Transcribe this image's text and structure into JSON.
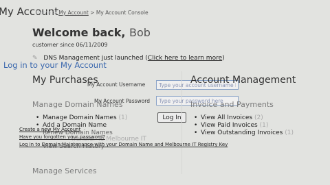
{
  "page_title": "My Account",
  "breadcrumb": {
    "home": "Home",
    "sep1": ">",
    "account": "My Account",
    "sep2": ">",
    "current": "My Account Console"
  },
  "welcome": {
    "greeting": "Welcome back,",
    "name": "Bob",
    "customer_since": "customer since 06/11/2009"
  },
  "announcement": {
    "text": "DNS Management just launched (",
    "link": "Click here to learn more",
    "close": ")"
  },
  "login_overlay": {
    "title": "Log in to your My Account",
    "username_label": "My Account Username",
    "username_placeholder": "Type your account username here",
    "password_label": "My Account Password",
    "password_placeholder": "Type your password here",
    "login_button": "Log In",
    "create_link": "Create a new My Account",
    "forgot_link": "Have you forgotten your password?",
    "legacy_link": "Log in to Domain Maintenance with your Domain Name and Melbourne IT Registry Key"
  },
  "my_purchases": {
    "heading": "My Purchases",
    "manage_domain_names_heading": "Manage Domain Names",
    "manage_services_heading": "Manage Services"
  },
  "domain_list": [
    {
      "label": "Manage Domain Names",
      "count": "(1)"
    },
    {
      "label": "Add a Domain Name",
      "count": ""
    }
  ],
  "ghost_items": {
    "renew": "Renew Domain Names",
    "transfer": "Transfer To Melbourne IT",
    "history": "View Search History"
  },
  "account_management": {
    "heading": "Account Management",
    "invoices_heading": "Invoice and Payments"
  },
  "invoice_list": [
    {
      "label": "View All Invoices",
      "count": "(2)"
    },
    {
      "label": "View Paid Invoices",
      "count": "(1)"
    },
    {
      "label": "View Outstanding Invoices",
      "count": "(1)"
    }
  ]
}
